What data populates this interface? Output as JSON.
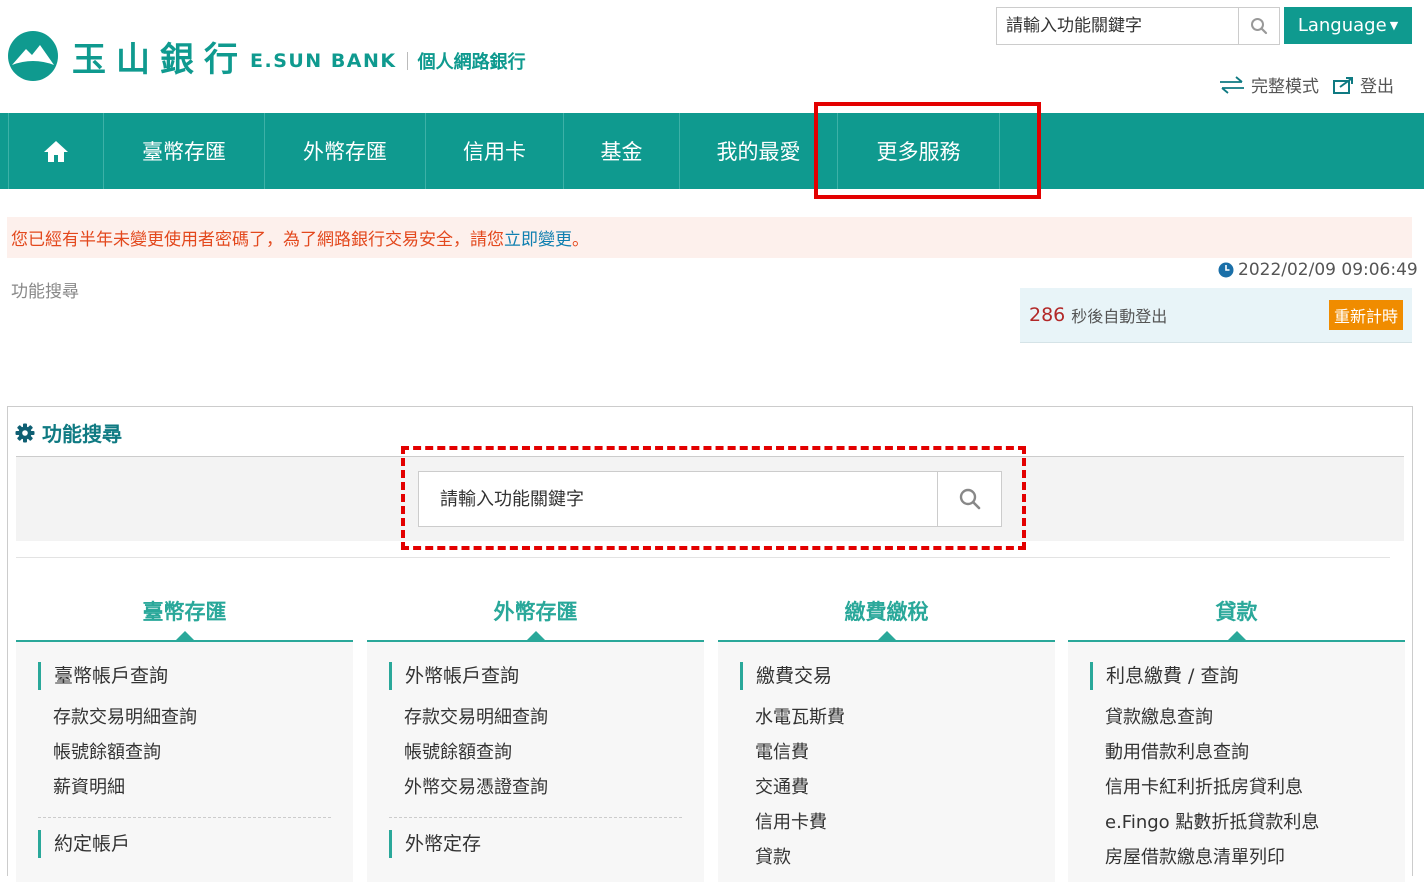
{
  "brand": {
    "name_cn": "玉山銀行",
    "name_en": "E.SUN BANK",
    "subtitle": "個人網路銀行",
    "color": "#0f9a8f"
  },
  "header": {
    "search_placeholder": "請輸入功能關鍵字",
    "language_label": "Language",
    "full_mode_label": "完整模式",
    "logout_label": "登出"
  },
  "nav": {
    "home_icon": "home-icon",
    "items": [
      {
        "label": "臺幣存匯"
      },
      {
        "label": "外幣存匯"
      },
      {
        "label": "信用卡"
      },
      {
        "label": "基金"
      },
      {
        "label": "我的最愛"
      },
      {
        "label": "更多服務"
      }
    ]
  },
  "notice": {
    "text": "您已經有半年未變更使用者密碼了，為了網路銀行交易安全，請您",
    "link": "立即變更",
    "end": "。"
  },
  "breadcrumb": "功能搜尋",
  "datetime": "2022/02/09 09:06:49",
  "timer": {
    "seconds": "286",
    "text": "秒後自動登出",
    "reset_label": "重新計時"
  },
  "panel": {
    "title": "功能搜尋",
    "search_placeholder": "請輸入功能關鍵字"
  },
  "columns": [
    {
      "title": "臺幣存匯",
      "group1": "臺幣帳戶查詢",
      "links": [
        "存款交易明細查詢",
        "帳號餘額查詢",
        "薪資明細"
      ],
      "group2": "約定帳戶"
    },
    {
      "title": "外幣存匯",
      "group1": "外幣帳戶查詢",
      "links": [
        "存款交易明細查詢",
        "帳號餘額查詢",
        "外幣交易憑證查詢"
      ],
      "group2": "外幣定存"
    },
    {
      "title": "繳費繳稅",
      "group1": "繳費交易",
      "links": [
        "水電瓦斯費",
        "電信費",
        "交通費",
        "信用卡費",
        "貸款"
      ]
    },
    {
      "title": "貸款",
      "group1": "利息繳費 / 查詢",
      "links": [
        "貸款繳息查詢",
        "動用借款利息查詢",
        "信用卡紅利折抵房貸利息",
        "e.Fingo 點數折抵貸款利息",
        "房屋借款繳息清單列印"
      ]
    }
  ]
}
